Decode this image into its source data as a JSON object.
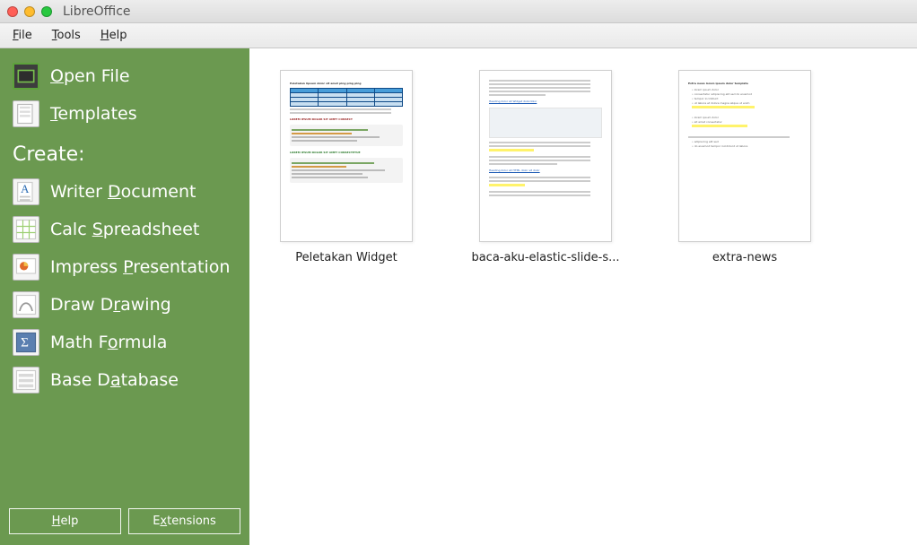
{
  "app_title": "LibreOffice",
  "menus": {
    "file": "File",
    "tools": "Tools",
    "help": "Help"
  },
  "sidebar": {
    "open_file": "Open File",
    "templates": "Templates",
    "create_label": "Create:",
    "writer": "Writer Document",
    "calc": "Calc Spreadsheet",
    "impress": "Impress Presentation",
    "draw": "Draw Drawing",
    "math": "Math Formula",
    "base": "Base Database",
    "help_button": "Help",
    "extensions_button": "Extensions"
  },
  "documents": [
    {
      "label": "Peletakan Widget"
    },
    {
      "label": "baca-aku-elastic-slide-s..."
    },
    {
      "label": "extra-news"
    }
  ]
}
